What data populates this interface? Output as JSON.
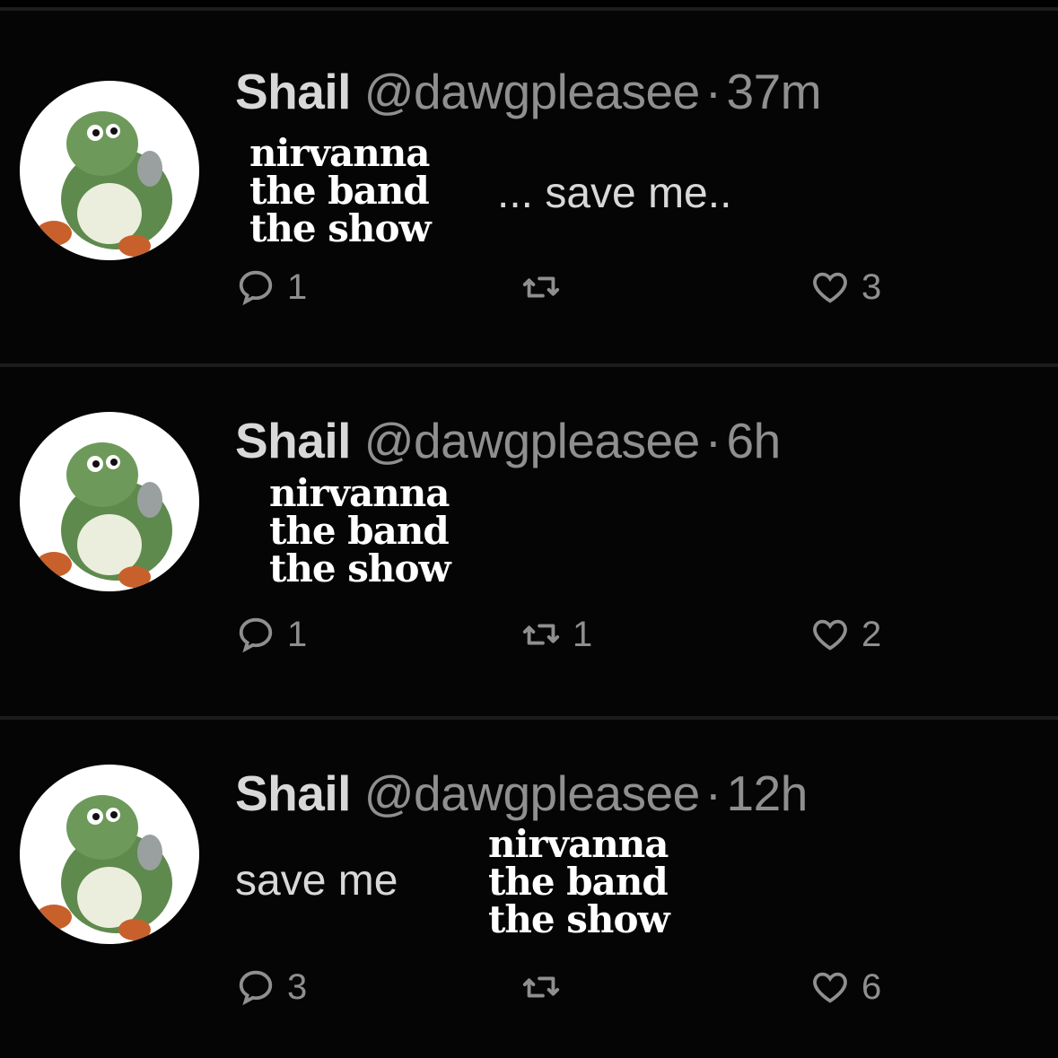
{
  "tweets": [
    {
      "name": "Shail",
      "handle": "@dawgpleasee",
      "separator": "·",
      "time": "37m",
      "text": "... save me..",
      "overlay": [
        "nirvanna",
        "the band",
        "the show"
      ],
      "replies": "1",
      "retweets": "",
      "likes": "3"
    },
    {
      "name": "Shail",
      "handle": "@dawgpleasee",
      "separator": "·",
      "time": "6h",
      "text": "",
      "overlay": [
        "nirvanna",
        "the band",
        "the show"
      ],
      "replies": "1",
      "retweets": "1",
      "likes": "2"
    },
    {
      "name": "Shail",
      "handle": "@dawgpleasee",
      "separator": "·",
      "time": "12h",
      "text": "save me",
      "overlay": [
        "nirvanna",
        "the band",
        "the show"
      ],
      "replies": "3",
      "retweets": "",
      "likes": "6"
    }
  ],
  "icons": {
    "avatar": "green-dinosaur-avatar-icon",
    "reply": "reply-bubble-icon",
    "retweet": "retweet-icon",
    "like": "heart-icon"
  },
  "colors": {
    "background": "#000000",
    "text_primary": "#d8d8d8",
    "text_secondary": "#8f8f8f",
    "overlay_text": "#ffffff"
  }
}
